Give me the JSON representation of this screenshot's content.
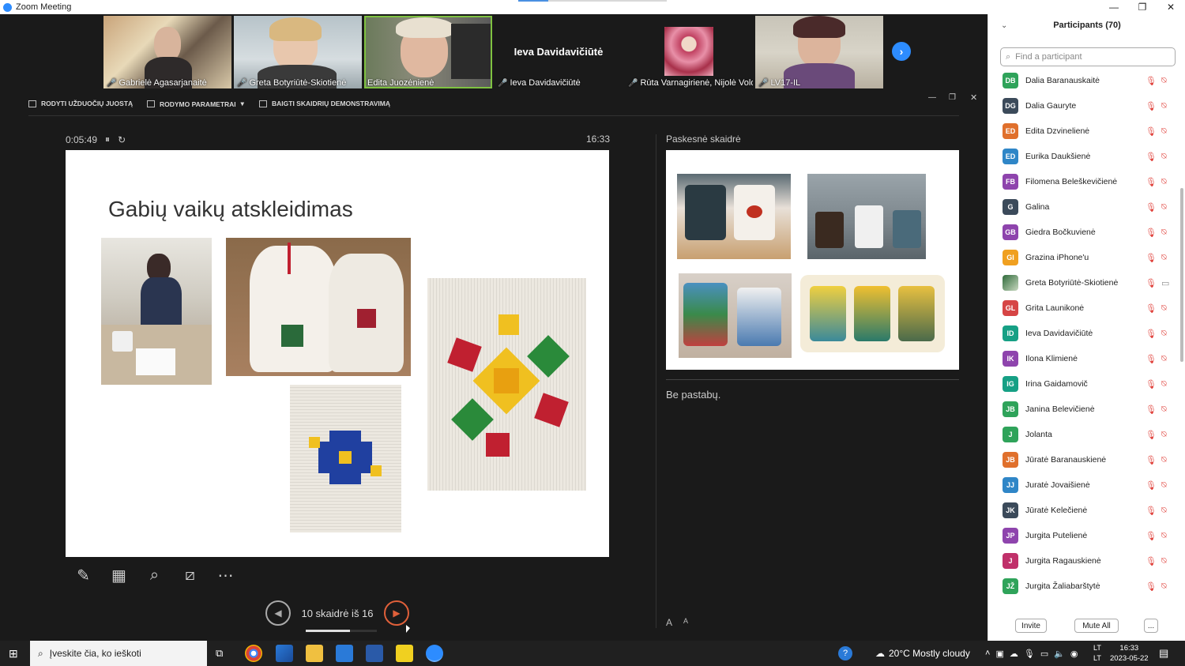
{
  "window": {
    "title": "Zoom Meeting"
  },
  "video_tiles": [
    {
      "name": "Gabrielė Agasarjanaitė",
      "muted": true,
      "active": false
    },
    {
      "name": "Greta Botyriūtė-Skiotienė",
      "muted": true,
      "active": false
    },
    {
      "name": "Edita Juozėnienė",
      "muted": false,
      "active": true
    },
    {
      "name": "Ieva Davidavičiūtė",
      "display_name": "Ieva Davidavičiūtė",
      "muted": true,
      "active": false
    },
    {
      "name": "Rūta Varnagirienė, Nijolė Volo...",
      "muted": true,
      "active": false
    },
    {
      "name": "LV17-IL",
      "muted": true,
      "active": false
    }
  ],
  "share_toolbar": {
    "show_taskbar": "RODYTI UŽDUOČIŲ JUOSTĄ",
    "display_settings": "RODYMO PARAMETRAI",
    "end_slideshow": "BAIGTI SKAIDRIŲ DEMONSTRAVIMĄ"
  },
  "presenter": {
    "elapsed": "0:05:49",
    "clock": "16:33",
    "slide_title": "Gabių vaikų atskleidimas",
    "next_slide_label": "Paskesnė skaidrė",
    "notes": "Be pastabų.",
    "page_indicator": "10 skaidrė iš 16",
    "progress": 0.625
  },
  "participants": {
    "header": "Participants (70)",
    "search_placeholder": "Find a participant",
    "invite_label": "Invite",
    "mute_all_label": "Mute All",
    "more_label": "...",
    "list": [
      {
        "initials": "DB",
        "name": "Dalia Baranauskaitė",
        "color": "#2fa35a",
        "video": false
      },
      {
        "initials": "DG",
        "name": "Dalia Gauryte",
        "color": "#3b4a5a",
        "video": false
      },
      {
        "initials": "ED",
        "name": "Edita Dzvinelienė",
        "color": "#e0702c",
        "video": false
      },
      {
        "initials": "ED",
        "name": "Eurika Daukšienė",
        "color": "#2f86c7",
        "video": false
      },
      {
        "initials": "FB",
        "name": "Filomena Beleškevičienė",
        "color": "#8e44ad",
        "video": false
      },
      {
        "initials": "G",
        "name": "Galina",
        "color": "#3b4a5a",
        "video": false
      },
      {
        "initials": "GB",
        "name": "Giedra Bočkuvienė",
        "color": "#8e44ad",
        "video": false
      },
      {
        "initials": "GI",
        "name": "Grazina iPhone'u",
        "color": "#f0a020",
        "video": false
      },
      {
        "initials": "",
        "name": "Greta Botyriūtė-Skiotienė",
        "color": "#2f6a3a",
        "video": true
      },
      {
        "initials": "GL",
        "name": "Grita Launikonė",
        "color": "#d64545",
        "video": false
      },
      {
        "initials": "ID",
        "name": "Ieva Davidavičiūtė",
        "color": "#16a085",
        "video": false
      },
      {
        "initials": "IK",
        "name": "Ilona Klimienė",
        "color": "#8e44ad",
        "video": false
      },
      {
        "initials": "IG",
        "name": "Irina Gaidamovič",
        "color": "#16a085",
        "video": false
      },
      {
        "initials": "JB",
        "name": "Janina Belevičienė",
        "color": "#2fa35a",
        "video": false
      },
      {
        "initials": "J",
        "name": "Jolanta",
        "color": "#2fa35a",
        "video": false
      },
      {
        "initials": "JB",
        "name": "Jūratė Baranauskienė",
        "color": "#e0702c",
        "video": false
      },
      {
        "initials": "JJ",
        "name": "Juratė Jovaišienė",
        "color": "#2f86c7",
        "video": false
      },
      {
        "initials": "JK",
        "name": "Jūratė Kelečienė",
        "color": "#3b4a5a",
        "video": false
      },
      {
        "initials": "JP",
        "name": "Jurgita Putelienė",
        "color": "#8e44ad",
        "video": false
      },
      {
        "initials": "J",
        "name": "Jurgita Ragauskienė",
        "color": "#c0306a",
        "video": false
      },
      {
        "initials": "JŽ",
        "name": "Jurgita Žaliabarštytė",
        "color": "#2fa35a",
        "video": false
      }
    ]
  },
  "taskbar": {
    "search_placeholder": "Įveskite čia, ko ieškoti",
    "weather": "20°C  Mostly cloudy",
    "time": "16:33",
    "date": "2023-05-22",
    "lang_top": "LT",
    "lang_bottom": "LT"
  }
}
